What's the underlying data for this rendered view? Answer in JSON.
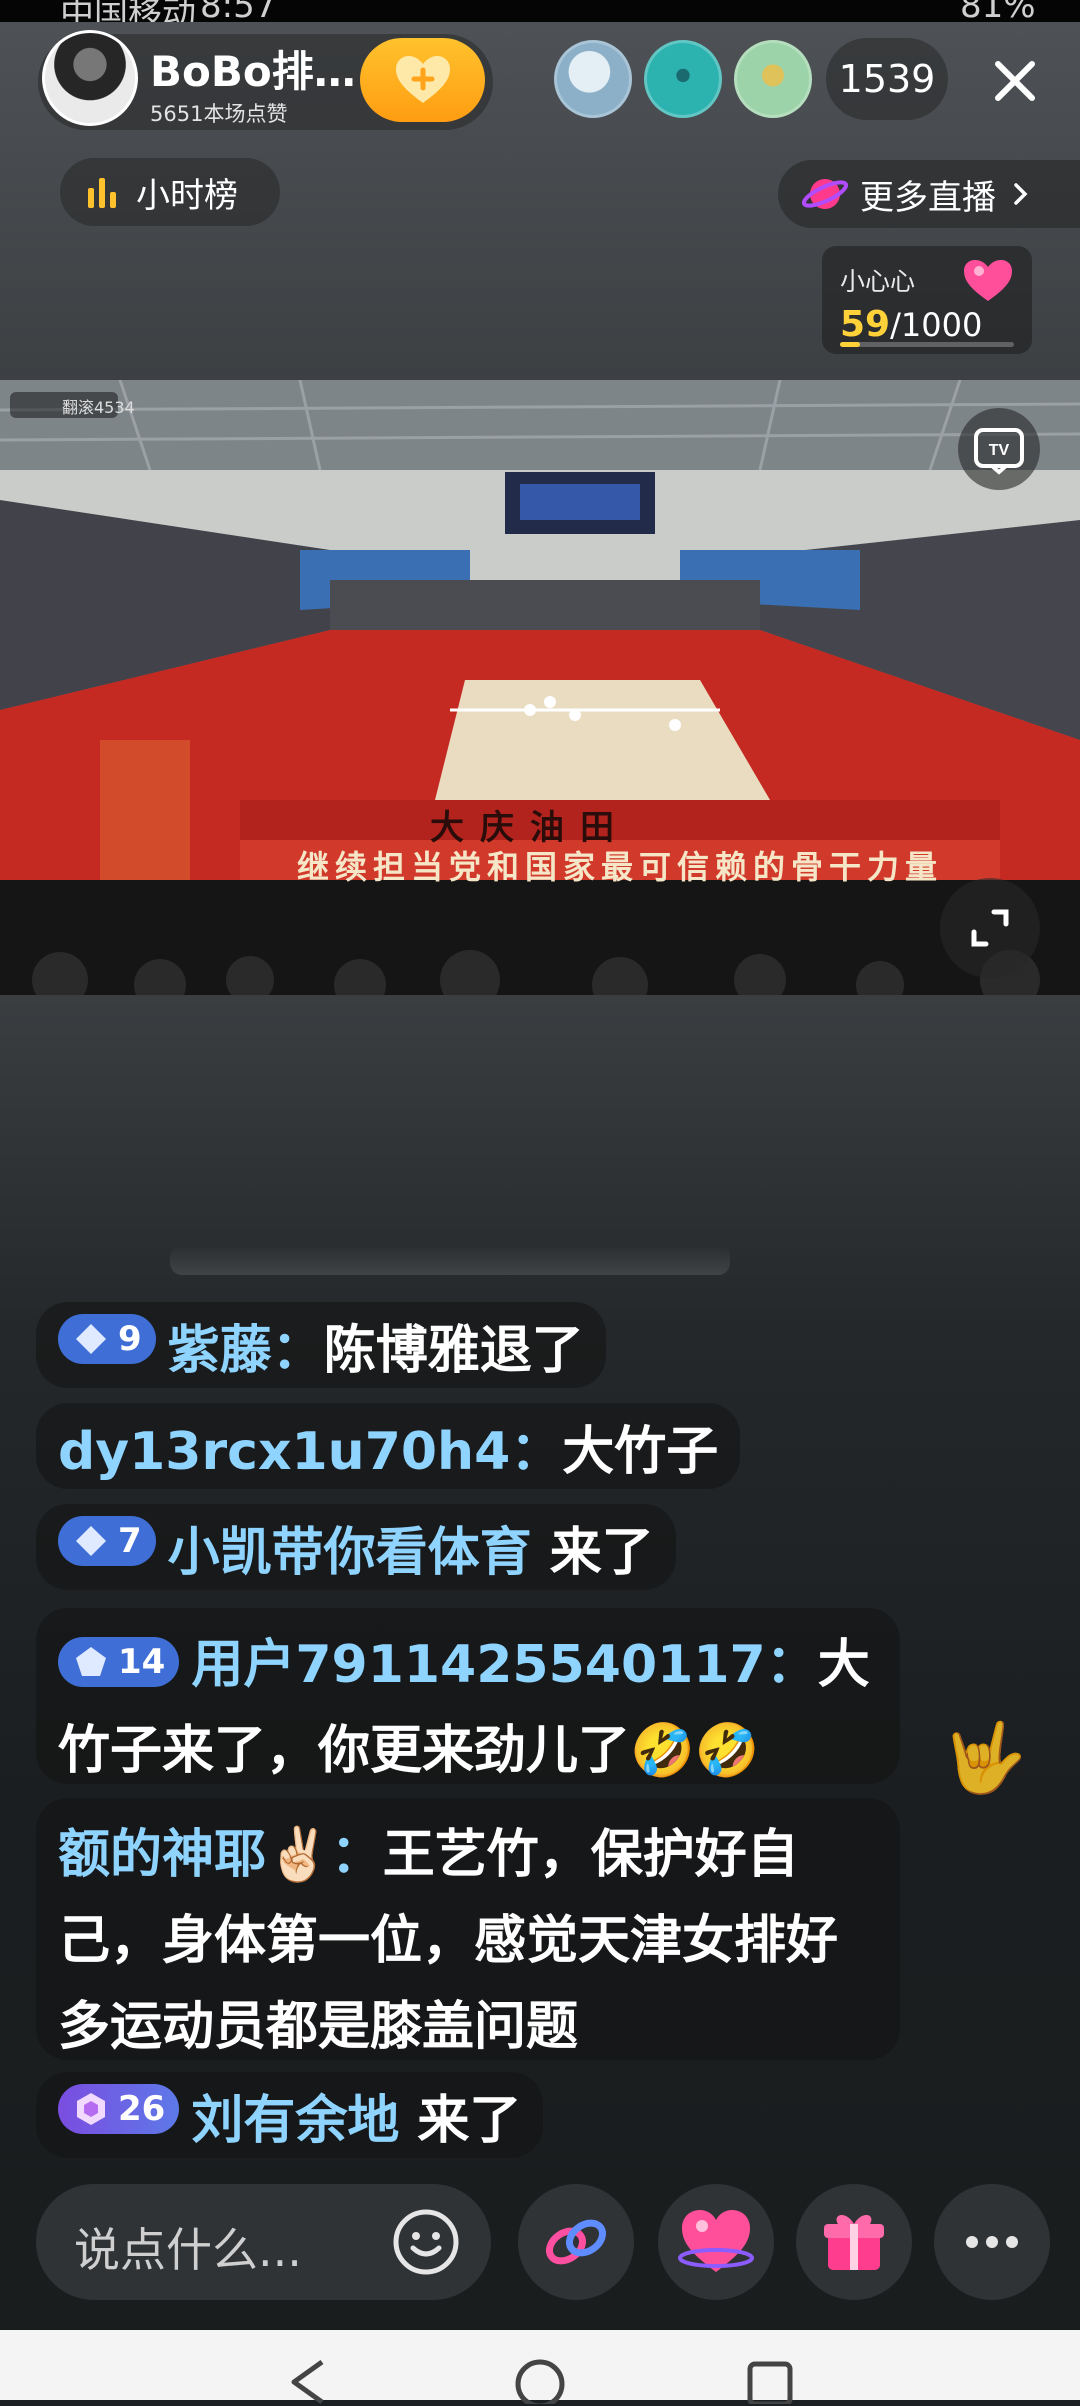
{
  "status_bar": {
    "carrier": "中国移动",
    "time": "8:57",
    "battery": "81%"
  },
  "header": {
    "host_name": "BoBo排…",
    "likes": "5651本场点赞",
    "viewer_count": "1539"
  },
  "hour_rank": {
    "label": "小时榜"
  },
  "more_live": {
    "label": "更多直播"
  },
  "heart_task": {
    "title": "小心心",
    "current": "59",
    "total": "/1000",
    "progress": 0.059
  },
  "video": {
    "streamer_tag": "翻滚4534",
    "banner_text": "继续担当党和国家最可信赖的骨干力量",
    "sponsor_text": "大庆油田"
  },
  "chat": [
    {
      "level": "9",
      "name": "紫藤：",
      "message": "陈博雅退了"
    },
    {
      "name": "dy13rcx1u70h4：",
      "message": "大竹子"
    },
    {
      "level": "7",
      "name": "小凯带你看体育",
      "message": "来了"
    },
    {
      "level": "14",
      "name": "用户7911425540117：",
      "message": "大竹子来了，你更来劲儿了🤣🤣"
    },
    {
      "name": "额的神耶✌🏻：",
      "message": "王艺竹，保护好自己，身体第一位，感觉天津女排好多运动员都是膝盖问题"
    },
    {
      "level": "26",
      "name": "刘有余地",
      "message": "来了"
    }
  ],
  "input": {
    "placeholder": "说点什么..."
  },
  "colors": {
    "name_blue": "#8fd3ff",
    "badge_blue": "#3f6fd6",
    "follow_gold": "#ffb020",
    "progress_yellow": "#ffd23a"
  }
}
